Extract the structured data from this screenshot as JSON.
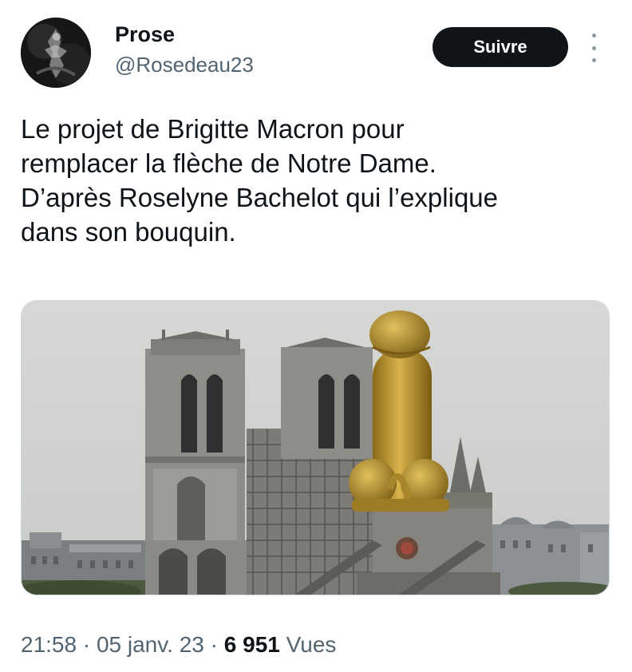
{
  "author": {
    "display_name": "Prose",
    "handle": "@Rosedeau23"
  },
  "follow_button": {
    "label": "Suivre"
  },
  "tweet": {
    "text": "Le projet de Brigitte Macron pour\nremplacer la flèche de Notre Dame.\nD’après Roselyne Bachelot qui l’explique\ndans son bouquin."
  },
  "meta": {
    "time": "21:58",
    "separator": "·",
    "date": "05 janv. 23",
    "views_count": "6 951",
    "views_label": "Vues"
  },
  "colors": {
    "text_primary": "#0f1419",
    "text_secondary": "#536471",
    "button_bg": "#0f1419",
    "button_text": "#ffffff"
  },
  "icons": {
    "more": "more-vertical-icon",
    "avatar": "avatar-image"
  }
}
